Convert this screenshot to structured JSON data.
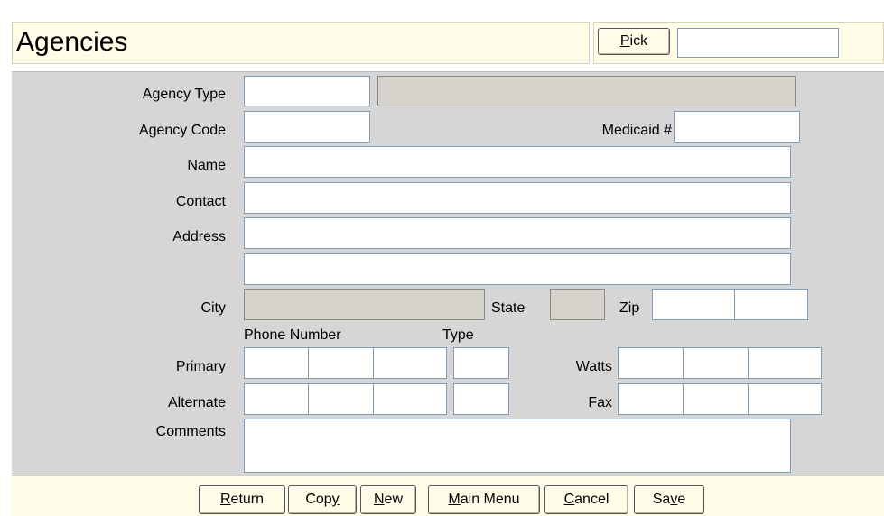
{
  "header": {
    "title": "Agencies",
    "pick_label": "Pick",
    "pick_key": "P",
    "pick_rest": "ick",
    "pick_value": ""
  },
  "form": {
    "agency_type_label": "Agency Type",
    "agency_code_label": "Agency Code",
    "medicaid_label": "Medicaid #",
    "name_label": "Name",
    "contact_label": "Contact",
    "address_label": "Address",
    "city_label": "City",
    "state_label": "State",
    "zip_label": "Zip",
    "phone_number_header": "Phone Number",
    "type_header": "Type",
    "primary_label": "Primary",
    "alternate_label": "Alternate",
    "watts_label": "Watts",
    "fax_label": "Fax",
    "comments_label": "Comments"
  },
  "footer": {
    "buttons": [
      {
        "pre": "",
        "key": "R",
        "post": "eturn"
      },
      {
        "pre": "Cop",
        "key": "y",
        "post": ""
      },
      {
        "pre": "",
        "key": "N",
        "post": "ew"
      },
      {
        "pre": "",
        "key": "M",
        "post": "ain Menu"
      },
      {
        "pre": "",
        "key": "C",
        "post": "ancel"
      },
      {
        "pre": "Sa",
        "key": "v",
        "post": "e"
      }
    ]
  }
}
